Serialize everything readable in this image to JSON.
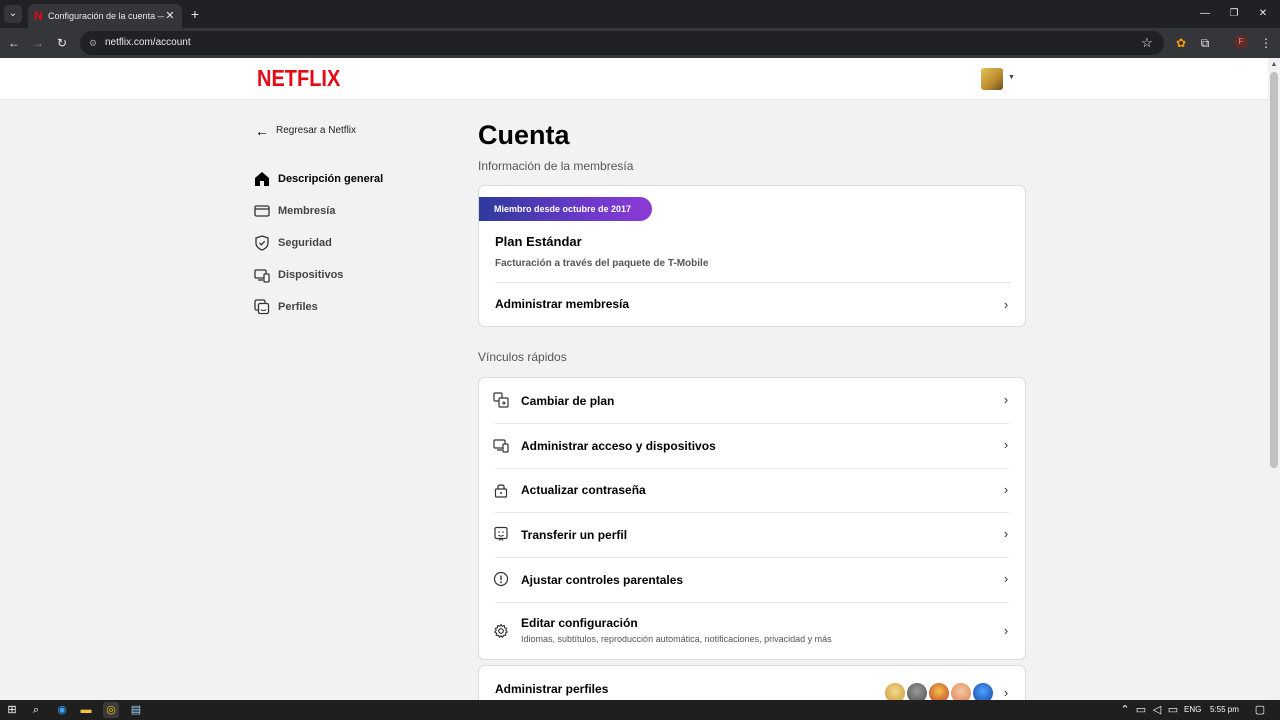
{
  "browser": {
    "tab_title": "Configuración de la cuenta — N",
    "tab_close": "✕",
    "new_tab": "+",
    "url": "netflix.com/account",
    "profile_initial": "F",
    "window_controls": [
      "—",
      "❐",
      "✕"
    ]
  },
  "header": {
    "logo": "NETFLIX"
  },
  "sidebar": {
    "back_label": "Regresar a Netflix",
    "items": [
      {
        "label": "Descripción general",
        "icon": "home-icon",
        "active": true
      },
      {
        "label": "Membresía",
        "icon": "card-icon",
        "active": false
      },
      {
        "label": "Seguridad",
        "icon": "shield-icon",
        "active": false
      },
      {
        "label": "Dispositivos",
        "icon": "devices-icon",
        "active": false
      },
      {
        "label": "Perfiles",
        "icon": "profiles-icon",
        "active": false
      }
    ]
  },
  "main": {
    "title": "Cuenta",
    "membership_section": "Información de la membresía",
    "member_badge": "Miembro desde octubre de 2017",
    "plan_name": "Plan Estándar",
    "plan_billing": "Facturación a través del paquete de T-Mobile",
    "manage_membership": "Administrar membresía",
    "quick_links_section": "Vínculos rápidos",
    "quick_links": [
      {
        "label": "Cambiar de plan",
        "icon": "change-plan-icon"
      },
      {
        "label": "Administrar acceso y dispositivos",
        "icon": "devices-icon"
      },
      {
        "label": "Actualizar contraseña",
        "icon": "lock-icon"
      },
      {
        "label": "Transferir un perfil",
        "icon": "transfer-profile-icon"
      },
      {
        "label": "Ajustar controles parentales",
        "icon": "alert-icon"
      },
      {
        "label": "Editar configuración",
        "sub": "Idiomas, subtítulos, reproducción automática, notificaciones, privacidad y más",
        "icon": "gear-icon"
      }
    ],
    "manage_profiles": "Administrar perfiles"
  },
  "taskbar": {
    "language": "ENG",
    "time": "5:55 pm"
  },
  "colors": {
    "brand": "#e50914",
    "badge_start": "#2c3a9d",
    "badge_end": "#8d3ad6"
  }
}
